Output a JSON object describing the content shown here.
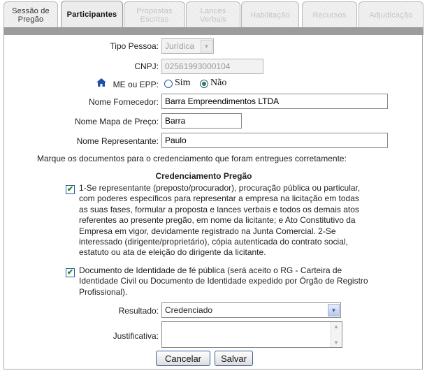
{
  "tabs": [
    {
      "label": "Sessão de\nPregão",
      "state": "enabled"
    },
    {
      "label": "Participantes",
      "state": "active"
    },
    {
      "label": "Propostas\nEscritas",
      "state": "disabled"
    },
    {
      "label": "Lances\nVerbais",
      "state": "disabled"
    },
    {
      "label": "Habilitação",
      "state": "disabled"
    },
    {
      "label": "Recursos",
      "state": "disabled"
    },
    {
      "label": "Adjudicação",
      "state": "disabled"
    }
  ],
  "form": {
    "tipo_pessoa": {
      "label": "Tipo Pessoa:",
      "value": "Jurídica"
    },
    "cnpj": {
      "label": "CNPJ:",
      "value": "02561993000104"
    },
    "me_epp": {
      "label": "ME ou EPP:",
      "option_sim": "Sim",
      "option_nao": "Não",
      "selected": "Não"
    },
    "nome_fornecedor": {
      "label": "Nome Fornecedor:",
      "value": "Barra Empreendimentos LTDA"
    },
    "nome_mapa": {
      "label": "Nome Mapa de Preço:",
      "value": "Barra"
    },
    "nome_representante": {
      "label": "Nome Representante:",
      "value": "Paulo"
    }
  },
  "instructions": "Marque os documentos para o credenciamento que foram entregues corretamente:",
  "section_title": "Credenciamento Pregão",
  "documents": [
    {
      "checked": true,
      "lines": [
        "1-Se representante (preposto/procurador), procuração pública ou particular,",
        "com poderes específicos para representar a empresa na licitação em todas",
        "as suas fases, formular a proposta e lances verbais e todos os demais atos",
        "referentes ao presente pregão, em nome da licitante; e Ato Constitutivo da",
        "Empresa em vigor, devidamente registrado na Junta Comercial. 2-Se",
        "interessado (dirigente/proprietário), cópia autenticada do contrato social,",
        "estatuto ou ata de eleição do dirigente da licitante."
      ]
    },
    {
      "checked": true,
      "lines": [
        "Documento de Identidade de fé pública (será aceito o RG - Carteira de",
        "Identidade Civil ou Documento de Identidade expedido por Órgão de Registro",
        "Profissional)."
      ]
    }
  ],
  "resultado": {
    "label": "Resultado:",
    "value": "Credenciado"
  },
  "justificativa": {
    "label": "Justificativa:",
    "value": ""
  },
  "buttons": {
    "cancel": "Cancelar",
    "save": "Salvar"
  },
  "icons": {
    "me_epp": "home-icon",
    "check": "checkmark-icon",
    "select_arrow": "chevron-down-icon"
  },
  "colors": {
    "tab_strip": "#9c9c9c",
    "button_border": "#3c5c9c",
    "check_mark": "#1d8a1d",
    "icon_blue": "#1f4fa8"
  }
}
